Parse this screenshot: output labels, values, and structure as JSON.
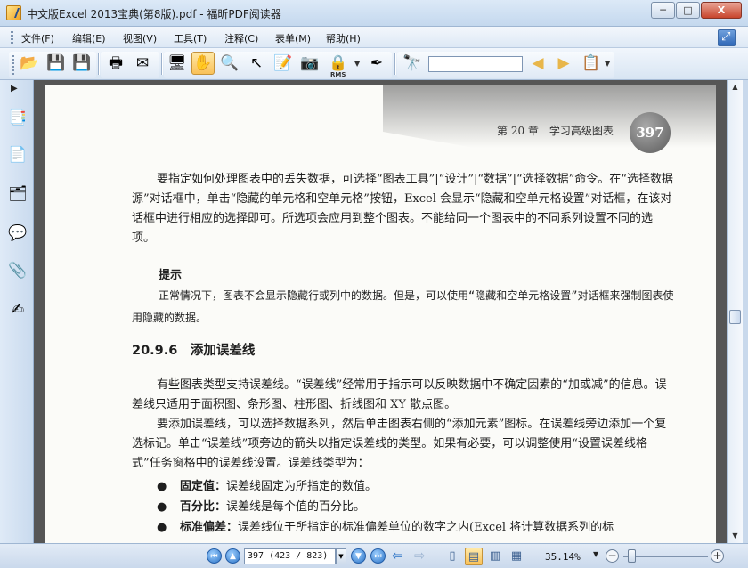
{
  "window": {
    "title": "中文版Excel 2013宝典(第8版).pdf - 福昕PDF阅读器",
    "min_label": "─",
    "max_label": "□",
    "close_label": "X"
  },
  "menu": {
    "items": [
      "文件(F)",
      "编辑(E)",
      "视图(V)",
      "工具(T)",
      "注释(C)",
      "表单(M)",
      "帮助(H)"
    ]
  },
  "toolbar": {
    "buttons": [
      {
        "name": "open-folder-icon",
        "glyph": "📂"
      },
      {
        "name": "save-icon",
        "glyph": "💾"
      },
      {
        "name": "save-as-icon",
        "glyph": "💾"
      },
      {
        "name": "print-icon",
        "glyph": "🖶"
      },
      {
        "name": "email-icon",
        "glyph": "✉"
      },
      {
        "name": "fullscreen-icon",
        "glyph": "🖥"
      },
      {
        "name": "hand-tool-icon",
        "glyph": "✋"
      },
      {
        "name": "zoom-tool-icon",
        "glyph": "🔍"
      },
      {
        "name": "select-arrow-icon",
        "glyph": "↖"
      },
      {
        "name": "text-select-icon",
        "glyph": "📝"
      },
      {
        "name": "snapshot-icon",
        "glyph": "📷"
      },
      {
        "name": "rms-lock-icon",
        "glyph": "🔒"
      },
      {
        "name": "sign-pen-icon",
        "glyph": "✒"
      },
      {
        "name": "find-binoculars-icon",
        "glyph": "🔭"
      },
      {
        "name": "find-prev-icon",
        "glyph": "◀"
      },
      {
        "name": "find-next-icon",
        "glyph": "▶"
      },
      {
        "name": "find-options-icon",
        "glyph": "📋"
      }
    ],
    "rms_label": "RMS",
    "search_value": ""
  },
  "left_panel": {
    "icons": [
      "bookmark-icon",
      "pages-icon",
      "layers-icon",
      "comments-icon",
      "attachments-icon",
      "signature-icon"
    ],
    "glyphs": [
      "📑",
      "📄",
      "🗂",
      "💬",
      "📎",
      "✍"
    ]
  },
  "document": {
    "chapter_header": "第 20 章　学习高级图表",
    "page_number": "397",
    "para1": "要指定如何处理图表中的丢失数据，可选择“图表工具”|“设计”|“数据”|“选择数据”命令。在“选择数据源”对话框中，单击“隐藏的单元格和空单元格”按钮，Excel 会显示“隐藏和空单元格设置”对话框，在该对话框中进行相应的选择即可。所选项会应用到整个图表。不能给同一个图表中的不同系列设置不同的选项。",
    "tip_title": "提示",
    "tip_body": "正常情况下，图表不会显示隐藏行或列中的数据。但是，可以使用“隐藏和空单元格设置”对话框来强制图表使用隐藏的数据。",
    "section_heading": "20.9.6　添加误差线",
    "para2": "有些图表类型支持误差线。“误差线”经常用于指示可以反映数据中不确定因素的“加或减”的信息。误差线只适用于面积图、条形图、柱形图、折线图和 XY 散点图。",
    "para3": "要添加误差线，可以选择数据系列，然后单击图表右侧的“添加元素”图标。在误差线旁边添加一个复选标记。单击“误差线”项旁边的箭头以指定误差线的类型。如果有必要，可以调整使用“设置误差线格式”任务窗格中的误差线设置。误差线类型为：",
    "bullets": [
      {
        "term": "固定值：",
        "text": "误差线固定为所指定的数值。"
      },
      {
        "term": "百分比：",
        "text": "误差线是每个值的百分比。"
      },
      {
        "term": "标准偏差：",
        "text": "误差线位于所指定的标准偏差单位的数字之内(Excel 将计算数据系列的标"
      }
    ]
  },
  "status": {
    "page_field": "397 (423 / 823)",
    "zoom": "35.14%",
    "zoom_slider_fraction": 0.1
  }
}
